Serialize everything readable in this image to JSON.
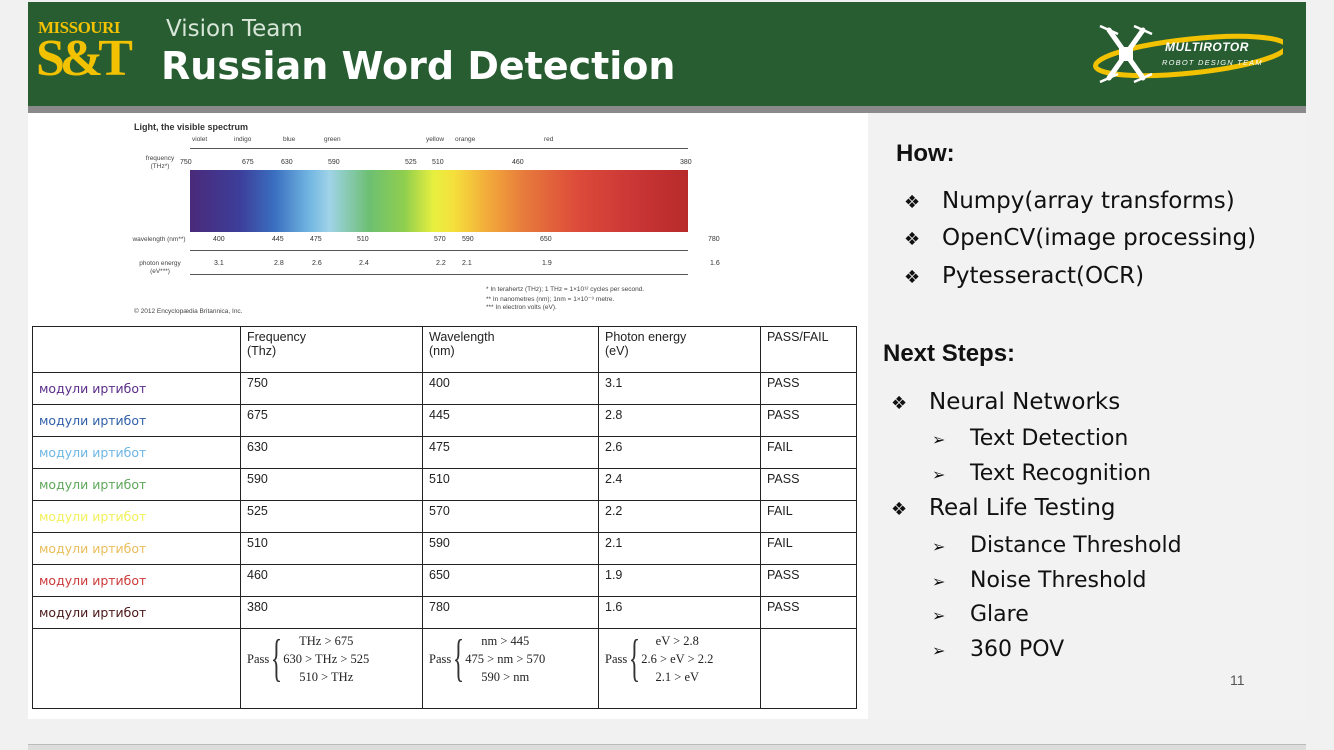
{
  "header": {
    "logo_top": "MISSOURI",
    "logo_main": "S&T",
    "subtitle": "Vision Team",
    "title": "Russian Word Detection",
    "team_logo_line1": "MULTIROTOR",
    "team_logo_line2": "ROBOT DESIGN TEAM"
  },
  "spectrum": {
    "title": "Light, the visible spectrum",
    "colors": [
      "violet",
      "indigo",
      "blue",
      "green",
      "yellow",
      "orange",
      "red"
    ],
    "frequency_label": "frequency (THz*)",
    "frequency_values": [
      "750",
      "675",
      "630",
      "590",
      "525",
      "510",
      "460",
      "380"
    ],
    "wavelength_label": "wavelength (nm**)",
    "wavelength_values": [
      "400",
      "445",
      "475",
      "510",
      "570",
      "590",
      "650",
      "780"
    ],
    "energy_label": "photon energy (eV***)",
    "energy_values": [
      "3.1",
      "2.8",
      "2.6",
      "2.4",
      "2.2",
      "2.1",
      "1.9",
      "1.6"
    ],
    "footnote1": "* In terahertz (THz); 1 THz = 1×10¹² cycles per second.",
    "footnote2": "** In nanometres (nm); 1nm = 1×10⁻⁹ metre.",
    "footnote3": "*** In electron volts (eV).",
    "copyright": "© 2012 Encyclopædia Britannica, Inc."
  },
  "table": {
    "headers": [
      "",
      "Frequency\n(Thz)",
      "Wavelength\n(nm)",
      "Photon energy\n(eV)",
      "PASS/FAIL"
    ],
    "rows": [
      {
        "word": "модули иртибот",
        "color": "#5a2d8a",
        "freq": "750",
        "wave": "400",
        "energy": "3.1",
        "result": "PASS"
      },
      {
        "word": "модули иртибот",
        "color": "#2f5fa8",
        "freq": "675",
        "wave": "445",
        "energy": "2.8",
        "result": "PASS"
      },
      {
        "word": "модули иртибот",
        "color": "#6db6e6",
        "freq": "630",
        "wave": "475",
        "energy": "2.6",
        "result": "FAIL"
      },
      {
        "word": "модули иртибот",
        "color": "#5ea85a",
        "freq": "590",
        "wave": "510",
        "energy": "2.4",
        "result": "PASS"
      },
      {
        "word": "модули иртибот",
        "color": "#f2f05a",
        "freq": "525",
        "wave": "570",
        "energy": "2.2",
        "result": "FAIL"
      },
      {
        "word": "модули иртибот",
        "color": "#eabd5a",
        "freq": "510",
        "wave": "590",
        "energy": "2.1",
        "result": "FAIL"
      },
      {
        "word": "модули иртибот",
        "color": "#cc3a3a",
        "freq": "460",
        "wave": "650",
        "energy": "1.9",
        "result": "PASS"
      },
      {
        "word": "модули иртибот",
        "color": "#4a1818",
        "freq": "380",
        "wave": "780",
        "energy": "1.6",
        "result": "PASS"
      }
    ],
    "pass_label": "Pass",
    "freq_conditions": [
      "THz > 675",
      "630 > THz > 525",
      "510 > THz"
    ],
    "wave_conditions": [
      "nm > 445",
      "475 > nm > 570",
      "590 > nm"
    ],
    "energy_conditions": [
      "eV > 2.8",
      "2.6 > eV > 2.2",
      "2.1 > eV"
    ]
  },
  "how": {
    "heading": "How:",
    "items": [
      "Numpy(array transforms)",
      "OpenCV(image processing)",
      "Pytesseract(OCR)"
    ]
  },
  "next_steps": {
    "heading": "Next Steps:",
    "item1": "Neural Networks",
    "item1_subs": [
      "Text Detection",
      "Text Recognition"
    ],
    "item2": "Real Life Testing",
    "item2_subs": [
      "Distance Threshold",
      "Noise Threshold",
      "Glare",
      "360 POV"
    ]
  },
  "bullet_symbol": "❖",
  "sub_symbol": "➢",
  "page_number": "11"
}
